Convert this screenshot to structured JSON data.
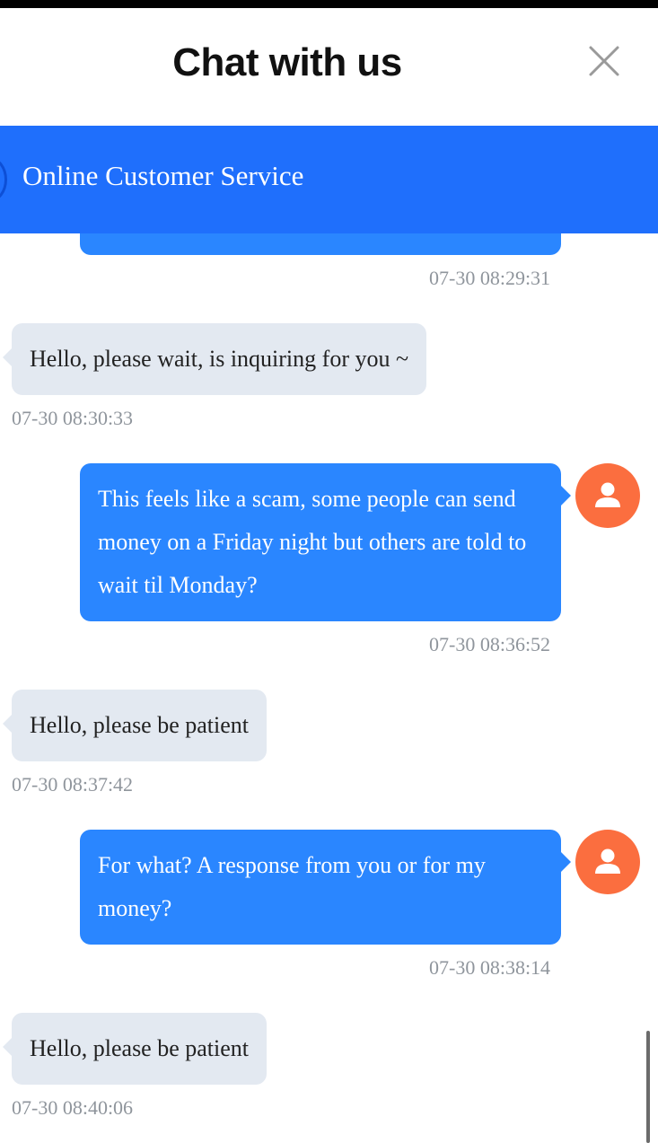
{
  "header": {
    "title": "Chat with us",
    "close_icon": "close-icon"
  },
  "service_bar": {
    "title": "Online Customer Service",
    "color": "#1f6ffc"
  },
  "colors": {
    "incoming_bubble": "#e3e9f1",
    "outgoing_bubble": "#2a86ff",
    "user_avatar": "#fb6e3f",
    "timestamp": "#8f959c"
  },
  "messages": [
    {
      "side": "outgoing",
      "text": "",
      "time": "07-30 08:29:31"
    },
    {
      "side": "incoming",
      "text": "Hello, please wait, is inquiring for you ~",
      "time": "07-30 08:30:33"
    },
    {
      "side": "outgoing",
      "text": "This feels like a scam, some people can send money on a Friday night but others are told to wait til Monday?",
      "time": "07-30 08:36:52",
      "avatar_icon": "user-icon"
    },
    {
      "side": "incoming",
      "text": "Hello, please be patient",
      "time": "07-30 08:37:42"
    },
    {
      "side": "outgoing",
      "text": "For what? A response from you or for my money?",
      "time": "07-30 08:38:14",
      "avatar_icon": "user-icon"
    },
    {
      "side": "incoming",
      "text": "Hello, please be patient",
      "time": "07-30 08:40:06"
    }
  ]
}
